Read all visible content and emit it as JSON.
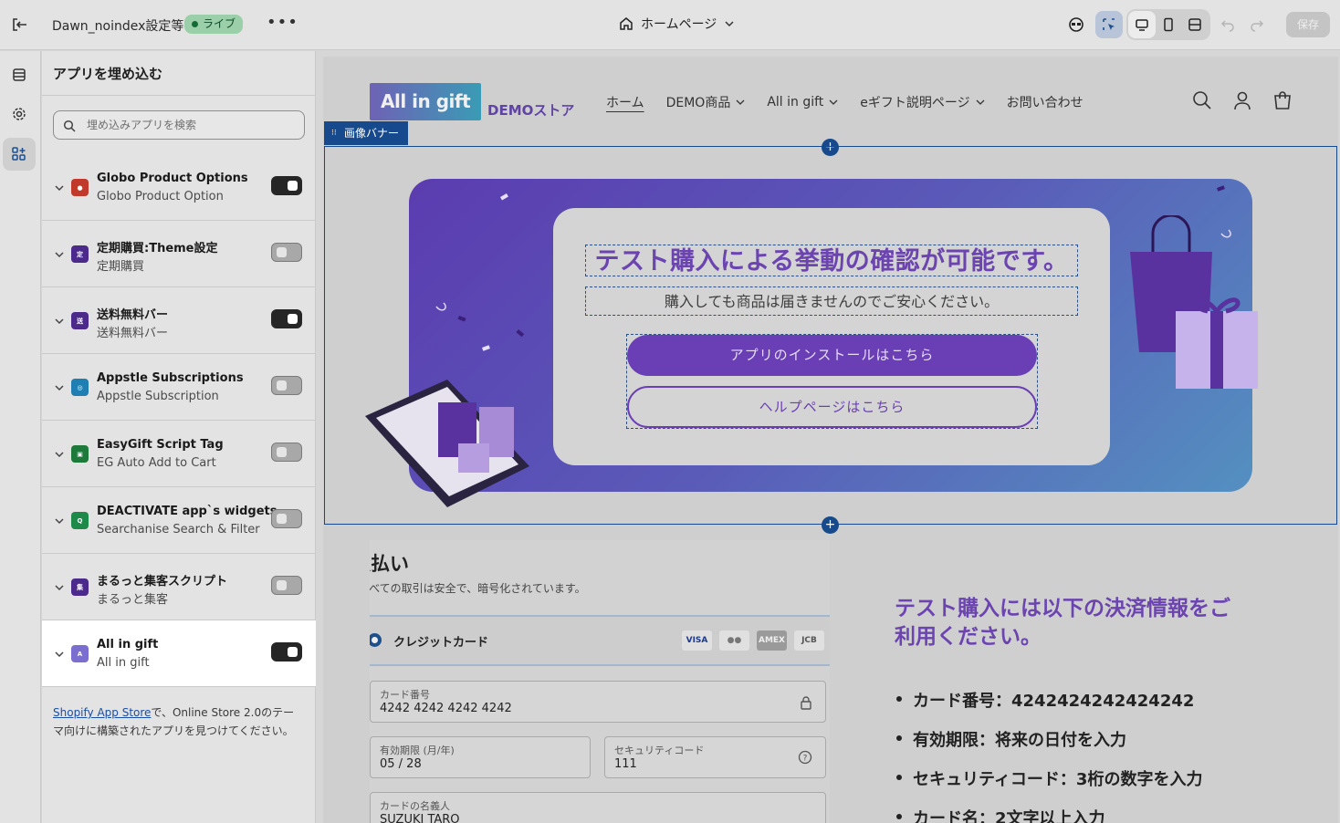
{
  "topbar": {
    "store_name": "Dawn_noindex設定等",
    "status_badge": "ライブ",
    "more": "•••",
    "page_selector": "ホームページ",
    "save_label": "保存"
  },
  "panel": {
    "title": "アプリを埋め込む",
    "search_placeholder": "埋め込みアプリを検索",
    "apps": [
      {
        "name": "Globo Product Options",
        "sub": "Globo Product Option",
        "enabled": true,
        "icon": "globo-icon",
        "icon_color": "#c0392b"
      },
      {
        "name": "定期購買:Theme設定",
        "sub": "定期購買",
        "enabled": false,
        "icon": "subscription-icon",
        "icon_color": "#4b2a8c"
      },
      {
        "name": "送料無料バー",
        "sub": "送料無料バー",
        "enabled": true,
        "icon": "free-shipping-icon",
        "icon_color": "#4b2a8c"
      },
      {
        "name": "Appstle Subscriptions",
        "sub": "Appstle Subscription",
        "enabled": false,
        "icon": "appstle-icon",
        "icon_color": "#1f7fb3"
      },
      {
        "name": "EasyGift Script Tag",
        "sub": "EG Auto Add to Cart",
        "enabled": false,
        "icon": "easygift-icon",
        "icon_color": "#1e7a3b"
      },
      {
        "name": "DEACTIVATE app`s widgets",
        "sub": "Searchanise Search & Filter",
        "enabled": false,
        "icon": "searchanise-icon",
        "icon_color": "#1e8a4a"
      },
      {
        "name": "まるっと集客スクリプト",
        "sub": "まるっと集客",
        "enabled": false,
        "icon": "marutto-icon",
        "icon_color": "#4b2a8c"
      },
      {
        "name": "All in gift",
        "sub": "All in gift",
        "enabled": true,
        "icon": "allingift-icon",
        "icon_color": "#7a6fd0"
      }
    ],
    "footnote_link": "Shopify App Store",
    "footnote_text": "で、Online Store 2.0のテーマ向けに構築されたアプリを見つけてください。"
  },
  "preview": {
    "logo_text": "All in gift",
    "store_label": "DEMOストア",
    "nav": [
      "ホーム",
      "DEMO商品",
      "All in gift",
      "eギフト説明ページ",
      "お問い合わせ"
    ],
    "section_tag": "画像バナー",
    "banner": {
      "headline": "テスト購入による挙動の確認が可能です。",
      "subline": "購入しても商品は届きませんのでご安心ください。",
      "button_primary": "アプリのインストールはこちら",
      "button_secondary": "ヘルプページはこちら"
    },
    "payment": {
      "title": "支払い",
      "subtitle": "すべての取引は安全で、暗号化されています。",
      "method": "クレジットカード",
      "card_brands": [
        "VISA",
        "●●",
        "AMEX",
        "JCB"
      ],
      "card_number_label": "カード番号",
      "card_number": "4242 4242 4242 4242",
      "expiry_label": "有効期限 (月/年)",
      "expiry": "05 / 28",
      "cvc_label": "セキュリティコード",
      "cvc": "111",
      "name_label": "カードの名義人",
      "name": "SUZUKI TARO"
    },
    "info": {
      "title": "テスト購入には以下の決済情報をご利用ください。",
      "items": [
        "カード番号：4242424242424242",
        "有効期限：将来の日付を入力",
        "セキュリティコード：3桁の数字を入力",
        "カード名：2文字以上入力"
      ]
    }
  }
}
